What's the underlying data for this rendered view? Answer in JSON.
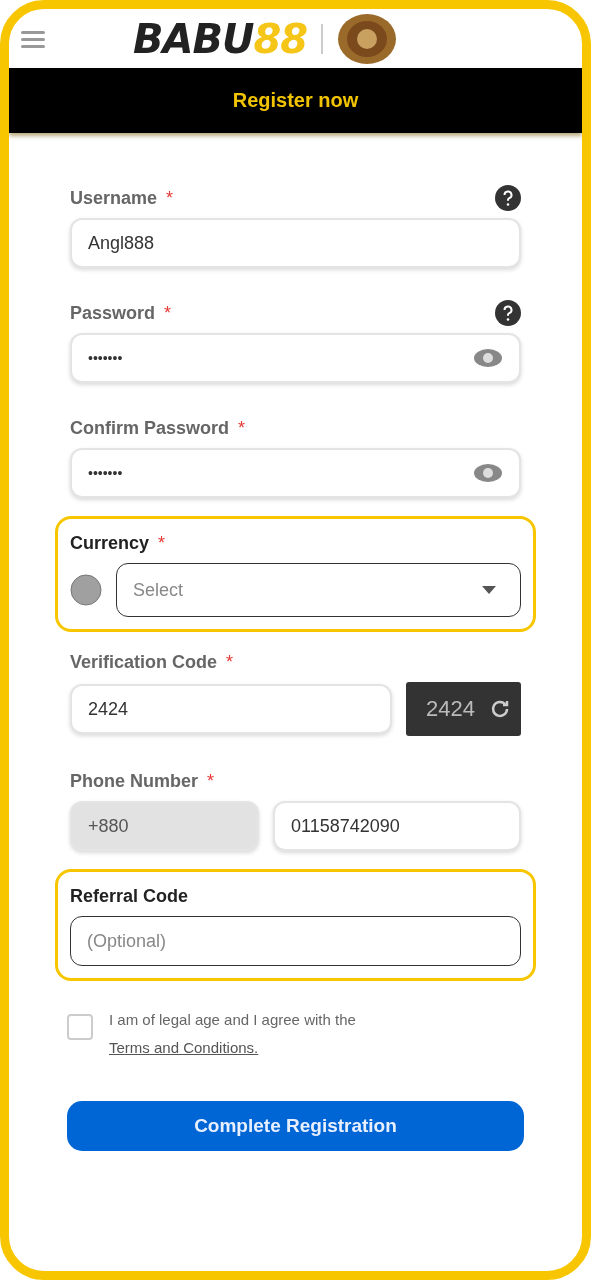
{
  "header": {
    "logo": [
      {
        "text": "BABU",
        "color": "#222222"
      },
      {
        "text": "88",
        "color": "#f5c518"
      }
    ]
  },
  "banner": {
    "title": "Register now"
  },
  "sections": [
    {
      "kind": "text",
      "label": "Username",
      "required_mark": "*",
      "help": true,
      "value": "Angl888",
      "highlighted": false
    },
    {
      "kind": "password",
      "label": "Password",
      "required_mark": "*",
      "help": true,
      "value": "•••••••",
      "highlighted": false
    },
    {
      "kind": "password",
      "label": "Confirm Password",
      "required_mark": "*",
      "help": false,
      "value": "•••••••",
      "highlighted": false
    },
    {
      "kind": "select",
      "label": "Currency",
      "required_mark": "*",
      "placeholder": "Select",
      "highlighted": true
    },
    {
      "kind": "captcha",
      "label": "Verification Code",
      "required_mark": "*",
      "value": "2424",
      "captcha": "2424",
      "highlighted": false
    },
    {
      "kind": "phone",
      "label": "Phone Number",
      "required_mark": "*",
      "prefix": "+880",
      "value": "01158742090",
      "highlighted": false
    },
    {
      "kind": "text",
      "label": "Referral Code",
      "placeholder": "(Optional)",
      "highlighted": true
    }
  ],
  "terms": {
    "checked": false,
    "text": "I am of legal age and I agree with the ",
    "link": "Terms and Conditions."
  },
  "submit": "Complete Registration"
}
